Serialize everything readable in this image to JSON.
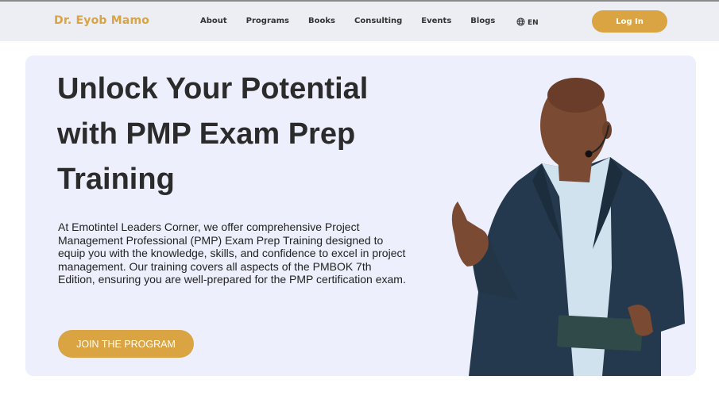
{
  "header": {
    "brand": "Dr. Eyob Mamo",
    "nav": [
      "About",
      "Programs",
      "Books",
      "Consulting",
      "Events",
      "Blogs"
    ],
    "language": "EN",
    "login_label": "Log In"
  },
  "hero": {
    "title": "Unlock Your Potential with PMP Exam Prep Training",
    "description": "At Emotintel Leaders Corner, we offer comprehensive Project Management Professional (PMP) Exam Prep Training designed to equip you with the knowledge, skills, and confidence to excel in project management. Our training covers all aspects of the PMBOK 7th Edition, ensuring you are well-prepared for the PMP certification exam.",
    "cta_label": "JOIN THE PROGRAM"
  },
  "colors": {
    "accent": "#d9a441",
    "nav_bg": "#eceef4",
    "hero_bg": "#edf0fc",
    "text": "#2b2b2b"
  },
  "icons": {
    "language": "globe-icon"
  }
}
